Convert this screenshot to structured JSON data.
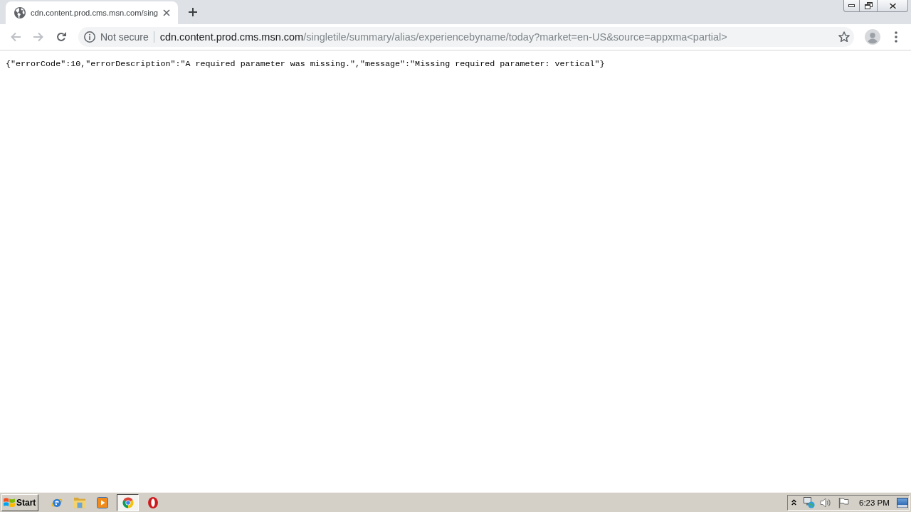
{
  "browser": {
    "tabs": [
      {
        "title": "cdn.content.prod.cms.msn.com/sing",
        "selected": true
      }
    ],
    "nav_buttons": [
      {
        "kind": "back",
        "disabled": true
      },
      {
        "kind": "forward",
        "disabled": true
      },
      {
        "kind": "reload",
        "disabled": false
      }
    ],
    "address_bar": {
      "security_label": "Not secure",
      "url_host": "cdn.content.prod.cms.msn.com",
      "url_path": "/singletile/summary/alias/experiencebyname/today?market=en-US&source=appxma<partial>"
    }
  },
  "page": {
    "text": "{\"errorCode\":10,\"errorDescription\":\"A required parameter was missing.\",\"message\":\"Missing required parameter: vertical\"}"
  },
  "taskbar": {
    "start_label": "Start",
    "apps": [
      {
        "kind": "ie",
        "selected": false
      },
      {
        "kind": "folder",
        "selected": false
      },
      {
        "kind": "player",
        "selected": false
      },
      {
        "kind": "chrome",
        "selected": true
      },
      {
        "kind": "opera",
        "selected": false
      }
    ],
    "clock": "6:23 PM"
  }
}
